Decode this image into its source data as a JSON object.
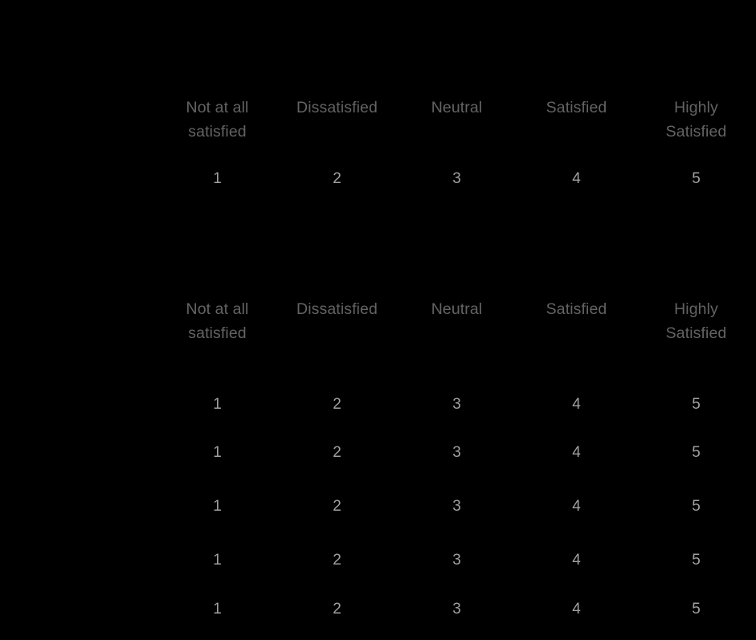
{
  "theme": {
    "background": "#000000",
    "header_text_color": "#636363",
    "value_text_color": "#a0a0a0"
  },
  "scale": {
    "labels": [
      "Not at all\nsatisfied",
      "Dissatisfied",
      "Neutral",
      "Satisfied",
      "Highly\nSatisfied"
    ],
    "values": [
      "1",
      "2",
      "3",
      "4",
      "5"
    ]
  },
  "section_one": {
    "header": {
      "col1": "Not at all\nsatisfied",
      "col2": "Dissatisfied",
      "col3": "Neutral",
      "col4": "Satisfied",
      "col5": "Highly\nSatisfied"
    },
    "row": {
      "label": "",
      "v1": "1",
      "v2": "2",
      "v3": "3",
      "v4": "4",
      "v5": "5"
    }
  },
  "section_two": {
    "header": {
      "col1": "Not at all\nsatisfied",
      "col2": "Dissatisfied",
      "col3": "Neutral",
      "col4": "Satisfied",
      "col5": "Highly\nSatisfied"
    },
    "rows": [
      {
        "label": "",
        "v1": "1",
        "v2": "2",
        "v3": "3",
        "v4": "4",
        "v5": "5"
      },
      {
        "label": "",
        "v1": "1",
        "v2": "2",
        "v3": "3",
        "v4": "4",
        "v5": "5"
      },
      {
        "label": "",
        "v1": "1",
        "v2": "2",
        "v3": "3",
        "v4": "4",
        "v5": "5"
      },
      {
        "label": "",
        "v1": "1",
        "v2": "2",
        "v3": "3",
        "v4": "4",
        "v5": "5"
      },
      {
        "label": "",
        "v1": "1",
        "v2": "2",
        "v3": "3",
        "v4": "4",
        "v5": "5"
      }
    ]
  }
}
